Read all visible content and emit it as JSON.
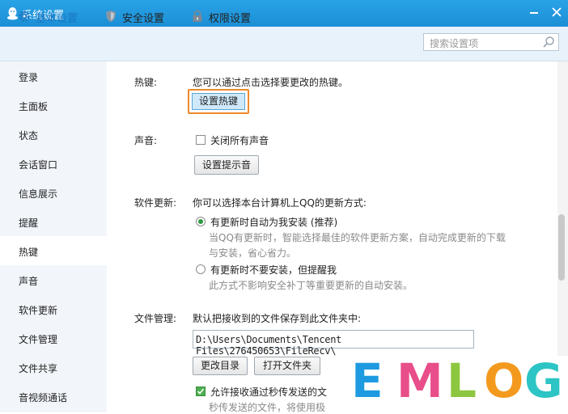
{
  "window": {
    "title": "系统设置"
  },
  "tabs": [
    {
      "label": "基本设置",
      "icon": "gear-icon",
      "active": true
    },
    {
      "label": "安全设置",
      "icon": "shield-icon",
      "active": false
    },
    {
      "label": "权限设置",
      "icon": "lock-icon",
      "active": false
    }
  ],
  "search": {
    "placeholder": "搜索设置项",
    "icon": "search-icon"
  },
  "sidebar": {
    "items": [
      {
        "label": "登录"
      },
      {
        "label": "主面板"
      },
      {
        "label": "状态"
      },
      {
        "label": "会话窗口"
      },
      {
        "label": "信息展示"
      },
      {
        "label": "提醒"
      },
      {
        "label": "热键",
        "selected": true
      },
      {
        "label": "声音"
      },
      {
        "label": "软件更新"
      },
      {
        "label": "文件管理"
      },
      {
        "label": "文件共享"
      },
      {
        "label": "音视频通话"
      }
    ]
  },
  "hotkey": {
    "label": "热键:",
    "desc": "您可以通过点击选择要更改的热键。",
    "button": "设置热键"
  },
  "sound": {
    "label": "声音:",
    "checkbox": "关闭所有声音",
    "checked": false,
    "button": "设置提示音"
  },
  "update": {
    "label": "软件更新:",
    "desc": "你可以选择本台计算机上QQ的更新方式:",
    "options": [
      {
        "label": "有更新时自动为我安装 (推荐)",
        "selected": true,
        "note1": "当QQ有更新时，智能选择最佳的软件更新方案，自动完成更新的下载",
        "note2": "与安装，省心省力。"
      },
      {
        "label": "有更新时不要安装，但提醒我",
        "selected": false,
        "note1": "此方式不影响安全补丁等重要更新的自动安装。"
      }
    ]
  },
  "files": {
    "label": "文件管理:",
    "desc": "默认把接收到的文件保存到此文件夹中:",
    "path": "D:\\Users\\Documents\\Tencent Files\\276450653\\FileRecv\\",
    "change_button": "更改目录",
    "open_button": "打开文件夹",
    "checkbox": "允许接收通过秒传发送的文",
    "checked": true,
    "partial_note": "秒传发送的文件，将使用极"
  },
  "watermark": {
    "text": [
      "E",
      "M",
      "L",
      "O",
      "G"
    ],
    "colors": [
      "#1e9be0",
      "#e84e8a",
      "#8dc63f",
      "#f39a1e",
      "#2cc4c4"
    ]
  }
}
